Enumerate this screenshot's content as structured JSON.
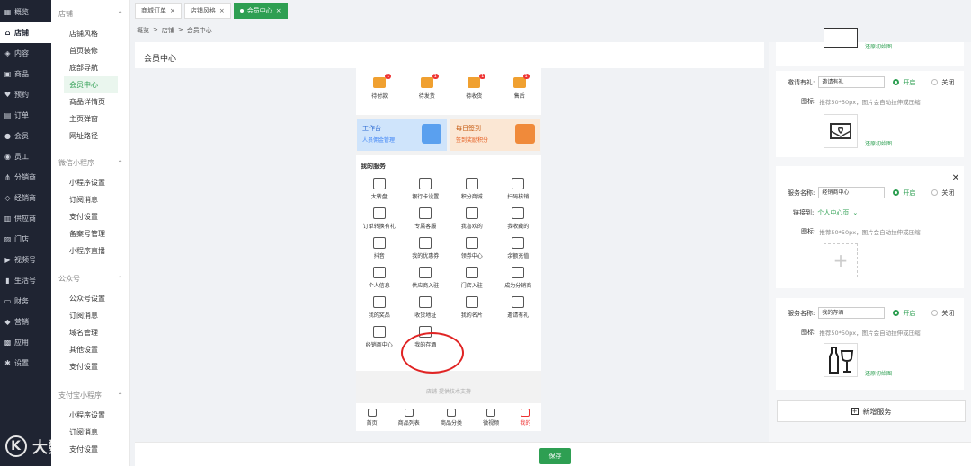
{
  "sidebar": {
    "items": [
      {
        "label": "概览",
        "icon": "grid-icon"
      },
      {
        "label": "店铺",
        "icon": "home-icon",
        "active": true
      },
      {
        "label": "内容",
        "icon": "layers-icon"
      },
      {
        "label": "商品",
        "icon": "box-icon"
      },
      {
        "label": "预约",
        "icon": "heart-icon"
      },
      {
        "label": "订单",
        "icon": "file-icon"
      },
      {
        "label": "会员",
        "icon": "user-icon"
      },
      {
        "label": "员工",
        "icon": "users-icon"
      },
      {
        "label": "分销商",
        "icon": "share-icon"
      },
      {
        "label": "经销商",
        "icon": "handshake-icon"
      },
      {
        "label": "供应商",
        "icon": "building-icon"
      },
      {
        "label": "门店",
        "icon": "store-icon"
      },
      {
        "label": "视频号",
        "icon": "video-icon"
      },
      {
        "label": "生活号",
        "icon": "bookmark-icon"
      },
      {
        "label": "财务",
        "icon": "wallet-icon"
      },
      {
        "label": "营销",
        "icon": "tag-icon"
      },
      {
        "label": "应用",
        "icon": "apps-icon"
      },
      {
        "label": "设置",
        "icon": "gear-icon"
      }
    ]
  },
  "watermark": {
    "text": "大数跨境"
  },
  "subnav": {
    "sections": [
      {
        "title": "店铺",
        "items": [
          "店铺风格",
          "首页装修",
          "底部导航",
          "会员中心",
          "商品详情页",
          "主页弹窗",
          "网址路径"
        ],
        "active": "会员中心"
      },
      {
        "title": "微信小程序",
        "items": [
          "小程序设置",
          "订阅消息",
          "支付设置",
          "备案号管理",
          "小程序直播"
        ]
      },
      {
        "title": "公众号",
        "items": [
          "公众号设置",
          "订阅消息",
          "域名管理",
          "其他设置",
          "支付设置"
        ]
      },
      {
        "title": "支付宝小程序",
        "items": [
          "小程序设置",
          "订阅消息",
          "支付设置"
        ]
      }
    ]
  },
  "tabs": [
    {
      "label": "商城订单"
    },
    {
      "label": "店铺风格"
    },
    {
      "label": "会员中心",
      "active": true
    }
  ],
  "breadcrumb": [
    "概览",
    "店铺",
    "会员中心"
  ],
  "page_title": "会员中心",
  "phone": {
    "orders": [
      {
        "label": "待付款",
        "badge": "1"
      },
      {
        "label": "待发货",
        "badge": "1"
      },
      {
        "label": "待收货",
        "badge": "1"
      },
      {
        "label": "售后",
        "badge": "1"
      }
    ],
    "banners": [
      {
        "title": "工作台",
        "sub": "人员佣金管理"
      },
      {
        "title": "每日签到",
        "sub": "签到奖励积分"
      }
    ],
    "services_title": "我的服务",
    "services": [
      "大转盘",
      "银行卡设置",
      "积分商城",
      "扫码核销",
      "订单转换有礼",
      "专属客服",
      "我喜欢的",
      "我收藏的",
      "抖音",
      "我的优惠券",
      "领券中心",
      "余额充值",
      "个人信息",
      "供应商入驻",
      "门店入驻",
      "成为分销商",
      "我的奖品",
      "收货地址",
      "我的名片",
      "邀请有礼",
      "经销商中心",
      "我的存酒"
    ],
    "support": "店铺·提供技术支持",
    "tabbar": [
      "首页",
      "商品列表",
      "商品分类",
      "微视频",
      "我的"
    ]
  },
  "right": {
    "restore": "还原初始图",
    "name_label": "服务名称:",
    "invite_label": "邀请有礼:",
    "on": "开启",
    "off": "关闭",
    "icon_label": "图标:",
    "hint": "推荐50*50px，图片会自动拉伸或压缩",
    "link_label": "链接到:",
    "link_value": "个人中心页",
    "card1": {
      "value": "邀请有礼"
    },
    "card2": {
      "value": "经销商中心"
    },
    "card3": {
      "value": "我的存酒"
    },
    "add_label": "新增服务"
  },
  "save_label": "保存"
}
